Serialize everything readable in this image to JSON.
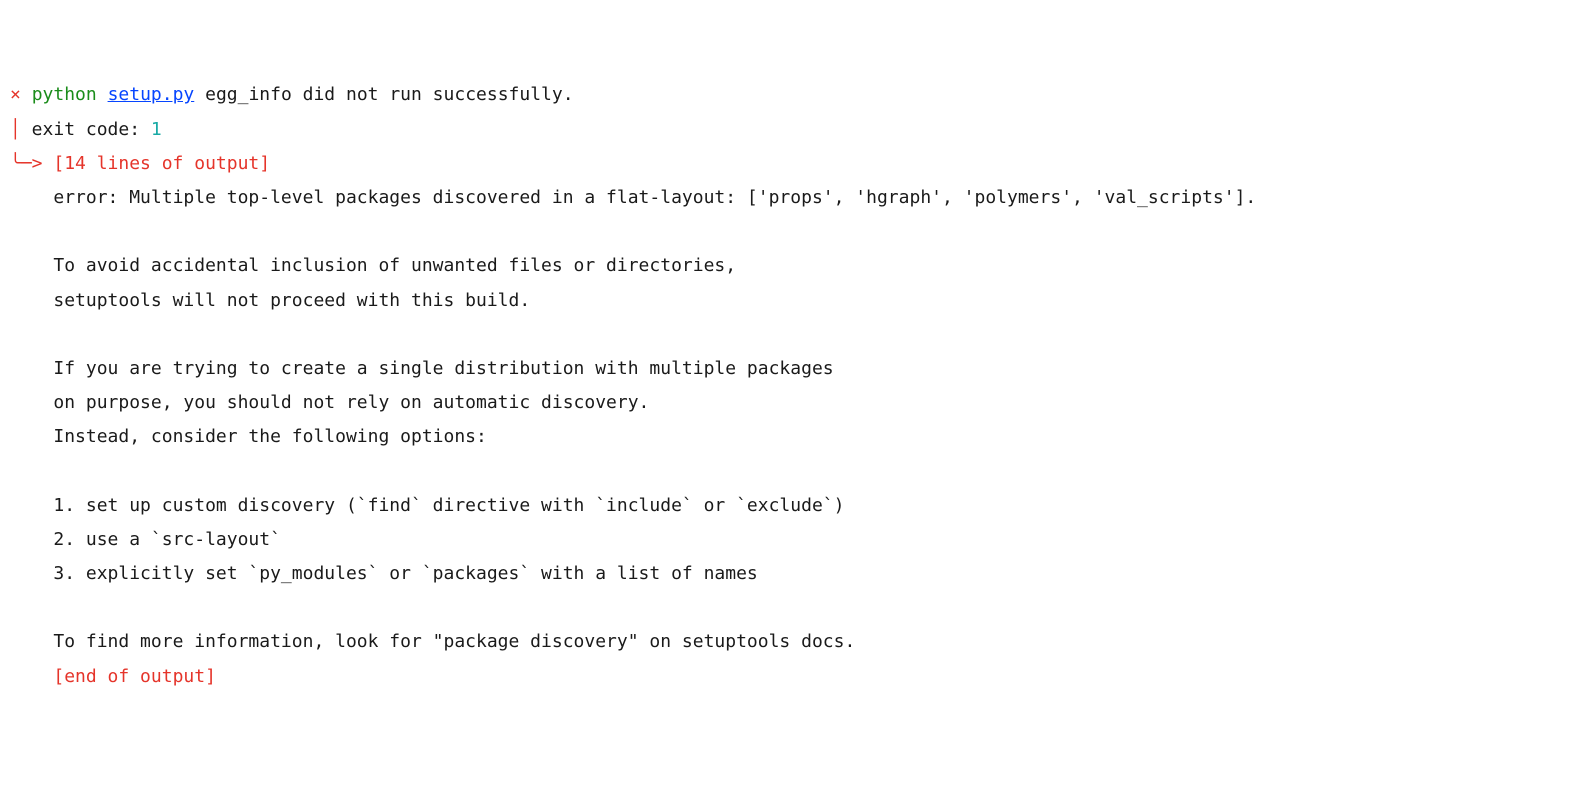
{
  "header": {
    "cross": "×",
    "python": "python",
    "setup_link": "setup.py",
    "after_setup": " egg_info did not run successfully."
  },
  "exit": {
    "pipe": "│",
    "label": " exit code: ",
    "code": "1"
  },
  "arrow": {
    "sym": "╰─>",
    "lines_of_output": " [14 lines of output]"
  },
  "body": {
    "indent": "    ",
    "l01": "error: Multiple top-level packages discovered in a flat-layout: ['props', 'hgraph', 'polymers', 'val_scripts'].",
    "l02": "",
    "l03": "To avoid accidental inclusion of unwanted files or directories,",
    "l04": "setuptools will not proceed with this build.",
    "l05": "",
    "l06": "If you are trying to create a single distribution with multiple packages",
    "l07": "on purpose, you should not rely on automatic discovery.",
    "l08": "Instead, consider the following options:",
    "l09": "",
    "l10": "1. set up custom discovery (`find` directive with `include` or `exclude`)",
    "l11": "2. use a `src-layout`",
    "l12": "3. explicitly set `py_modules` or `packages` with a list of names",
    "l13": "",
    "l14": "To find more information, look for \"package discovery\" on setuptools docs.",
    "end": "[end of output]"
  }
}
